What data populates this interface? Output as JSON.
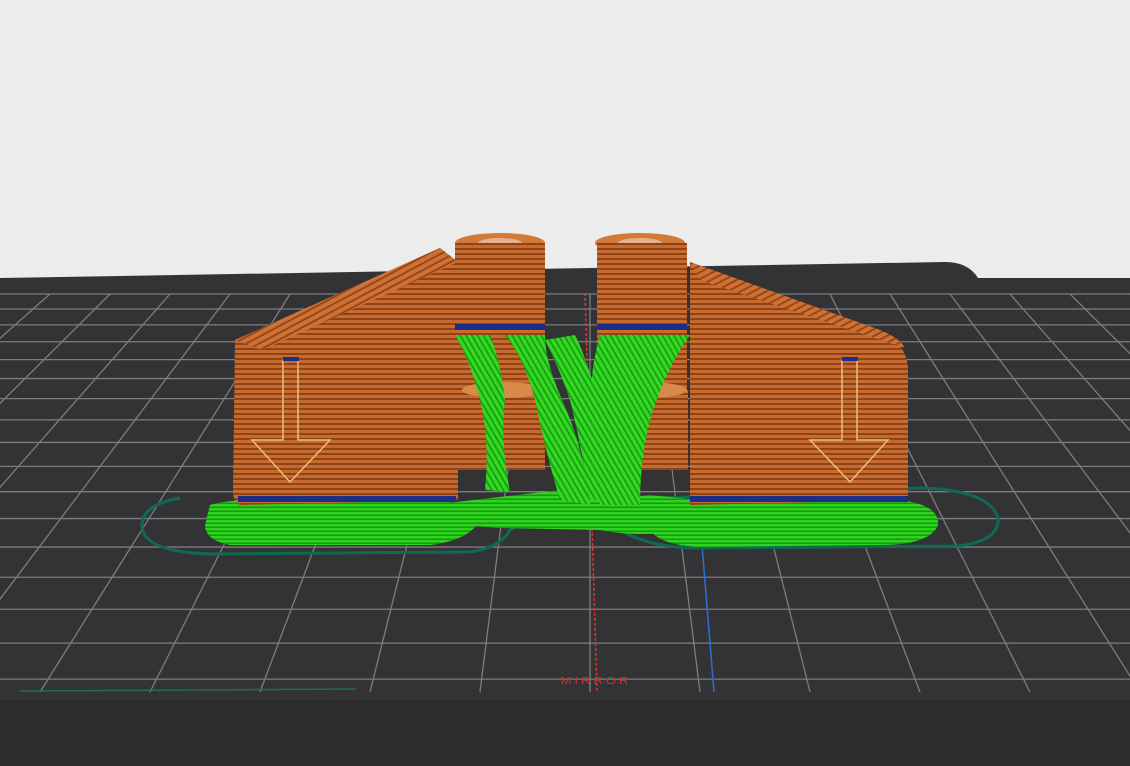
{
  "viewport": {
    "background_color": "#ececec",
    "bed_color": "#333336",
    "bed_edge_color": "#2c2c2e",
    "grid_color": "#7d7d80",
    "x_axis_color": "#e8322a",
    "y_axis_color": "#2a6fd6",
    "model_color": "#c0622a",
    "support_color": "#27c41a",
    "skirt_color": "#0e6b52",
    "bed_label": "MIRROR",
    "bed_label_color": "#c0392b"
  }
}
